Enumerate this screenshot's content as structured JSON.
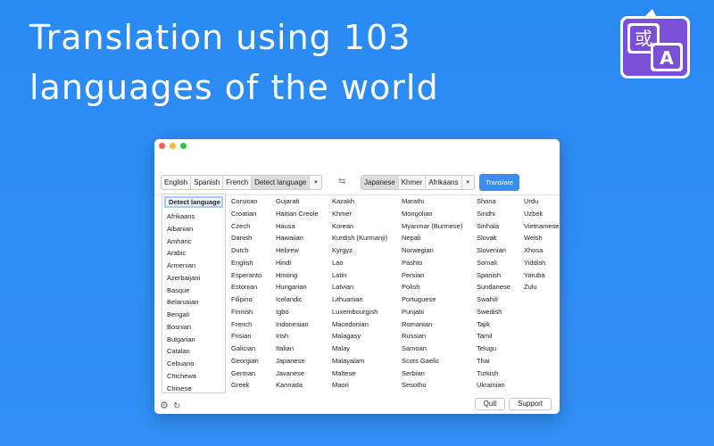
{
  "headline": {
    "line1": "Translation using 103",
    "line2": "languages of the world"
  },
  "app_icon": {
    "glyph_1": "或",
    "glyph_2": "A"
  },
  "colors": {
    "background": "#2f8ef5",
    "accent": "#3b8cf3",
    "icon_purple": "#7b4fd6"
  },
  "source_segments": [
    "English",
    "Spanish",
    "French",
    "Detect language"
  ],
  "source_selected": "Detect language",
  "target_segments": [
    "Japanese",
    "Khmer",
    "Afrikaans"
  ],
  "target_selected": "Japanese",
  "translate_label": "Translate",
  "source_list": {
    "selected": "Detect language",
    "items": [
      "Afrikaans",
      "Albanian",
      "Amharic",
      "Arabic",
      "Armenian",
      "Azerbaijani",
      "Basque",
      "Belarusian",
      "Bengali",
      "Bosnian",
      "Bulgarian",
      "Catalan",
      "Cebuano",
      "Chichewa",
      "Chinese"
    ]
  },
  "columns": [
    [
      "Corsican",
      "Croatian",
      "Czech",
      "Danish",
      "Dutch",
      "English",
      "Esperanto",
      "Estonian",
      "Filipino",
      "Finnish",
      "French",
      "Frisian",
      "Galician",
      "Georgian",
      "German",
      "Greek"
    ],
    [
      "Gujarati",
      "Haitian Creole",
      "Hausa",
      "Hawaiian",
      "Hebrew",
      "Hindi",
      "Hmong",
      "Hungarian",
      "Icelandic",
      "Igbo",
      "Indonesian",
      "Irish",
      "Italian",
      "Japanese",
      "Javanese",
      "Kannada"
    ],
    [
      "Kazakh",
      "Khmer",
      "Korean",
      "Kurdish (Kurmanji)",
      "Kyrgyz",
      "Lao",
      "Latin",
      "Latvian",
      "Lithuanian",
      "Luxembourgish",
      "Macedonian",
      "Malagasy",
      "Malay",
      "Malayalam",
      "Maltese",
      "Maori"
    ],
    [
      "Marathi",
      "Mongolian",
      "Myanmar (Burmese)",
      "Nepali",
      "Norwegian",
      "Pashto",
      "Persian",
      "Polish",
      "Portuguese",
      "Punjabi",
      "Romanian",
      "Russian",
      "Samoan",
      "Scots Gaelic",
      "Serbian",
      "Sesotho"
    ],
    [
      "Shona",
      "Sindhi",
      "Sinhala",
      "Slovak",
      "Slovenian",
      "Somali",
      "Spanish",
      "Sundanese",
      "Swahili",
      "Swedish",
      "Tajik",
      "Tamil",
      "Telugu",
      "Thai",
      "Turkish",
      "Ukrainian"
    ],
    [
      "Urdu",
      "Uzbek",
      "Vietnamese",
      "Welsh",
      "Xhosa",
      "Yiddish",
      "Yoruba",
      "Zulu"
    ]
  ],
  "footer": {
    "quit_label": "Quit",
    "support_label": "Support"
  },
  "icons": [
    "gear-icon",
    "refresh-icon",
    "swap-icon",
    "chevron-down-icon"
  ]
}
